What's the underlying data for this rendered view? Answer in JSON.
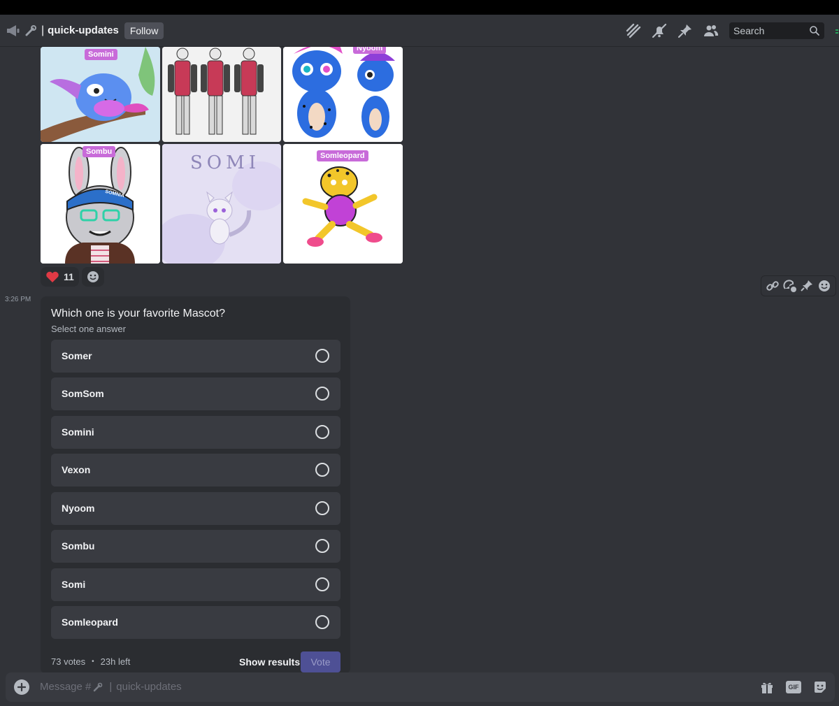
{
  "header": {
    "channel_name": "quick-updates",
    "separator": "|",
    "follow_label": "Follow",
    "search_placeholder": "Search"
  },
  "gallery": {
    "tags": {
      "somini": "Somini",
      "nyoom": "Nyoom",
      "sombu": "Sombu",
      "somi_text": "SOMI",
      "somleopard": "Somleopard"
    },
    "badge_text": "SOMNIA"
  },
  "reactions": {
    "heart_count": "11"
  },
  "message": {
    "timestamp": "3:26 PM"
  },
  "poll": {
    "question": "Which one is your favorite Mascot?",
    "subtitle": "Select one answer",
    "options": [
      "Somer",
      "SomSom",
      "Somini",
      "Vexon",
      "Nyoom",
      "Sombu",
      "Somi",
      "Somleopard"
    ],
    "votes": "73 votes",
    "time_left": "23h left",
    "dot": "•",
    "show_results_label": "Show results",
    "vote_label": "Vote"
  },
  "composer": {
    "placeholder_prefix": "Message #",
    "placeholder_sep": "|",
    "placeholder_channel": "quick-updates",
    "gif_label": "GIF"
  },
  "colors": {
    "background": "#313338",
    "poll_bg": "#2b2d31",
    "option_bg": "#393b41",
    "accent_tag": "#c86bd9",
    "vote_btn": "#4e5095",
    "heart": "#e03a45"
  },
  "icons": [
    "megaphone-icon",
    "threads-icon",
    "mute-bell-icon",
    "pin-icon",
    "members-icon",
    "search-icon",
    "link-icon",
    "thread-add-icon",
    "pin-icon",
    "emoji-icon",
    "plus-icon",
    "gift-icon",
    "gif-icon",
    "sticker-icon"
  ]
}
